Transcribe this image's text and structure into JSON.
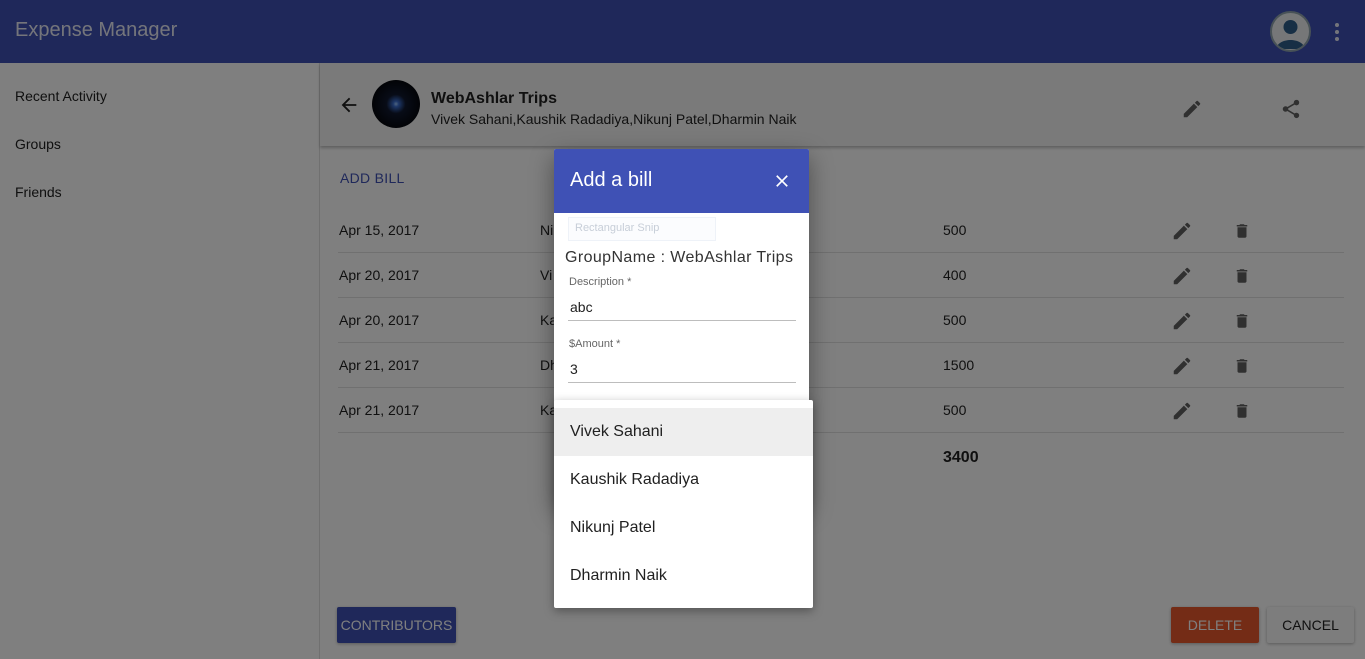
{
  "app": {
    "title": "Expense Manager"
  },
  "sidebar": {
    "items": [
      {
        "label": "Recent Activity"
      },
      {
        "label": "Groups"
      },
      {
        "label": "Friends"
      }
    ]
  },
  "group": {
    "name": "WebAshlar Trips",
    "members": "Vivek Sahani,Kaushik Radadiya,Nikunj Patel,Dharmin Naik"
  },
  "bills": {
    "add_label": "ADD BILL",
    "rows": [
      {
        "date": "Apr 15, 2017",
        "payer": "Ni",
        "amount": "500"
      },
      {
        "date": "Apr 20, 2017",
        "payer": "Vi",
        "amount": "400"
      },
      {
        "date": "Apr 20, 2017",
        "payer": "Ka",
        "amount": "500"
      },
      {
        "date": "Apr 21, 2017",
        "payer": "Dh",
        "amount": "1500"
      },
      {
        "date": "Apr 21, 2017",
        "payer": "Ka",
        "amount": "500"
      }
    ],
    "total": "3400"
  },
  "footer": {
    "contributors_label": "CONTRIBUTORS",
    "delete_label": "DELETE",
    "cancel_label": "CANCEL"
  },
  "dialog": {
    "title": "Add a bill",
    "snip_ghost": "Rectangular Snip",
    "group_label": "GroupName : WebAshlar Trips",
    "description_label": "Description *",
    "description_value": "abc",
    "amount_label": "$Amount *",
    "amount_value": "3"
  },
  "payer_menu": {
    "options": [
      {
        "label": "Vivek Sahani",
        "selected": true
      },
      {
        "label": "Kaushik Radadiya",
        "selected": false
      },
      {
        "label": "Nikunj Patel",
        "selected": false
      },
      {
        "label": "Dharmin Naik",
        "selected": false
      }
    ]
  },
  "colors": {
    "primary": "#3f51b5",
    "danger": "#e8582c",
    "overlay": "rgba(0,0,0,0.5)"
  },
  "icons": {
    "account": "account-circle-icon",
    "more": "more-vert-icon",
    "back": "arrow-back-icon",
    "edit": "pencil-icon",
    "share": "share-icon",
    "delete": "trash-icon",
    "close": "close-icon"
  }
}
